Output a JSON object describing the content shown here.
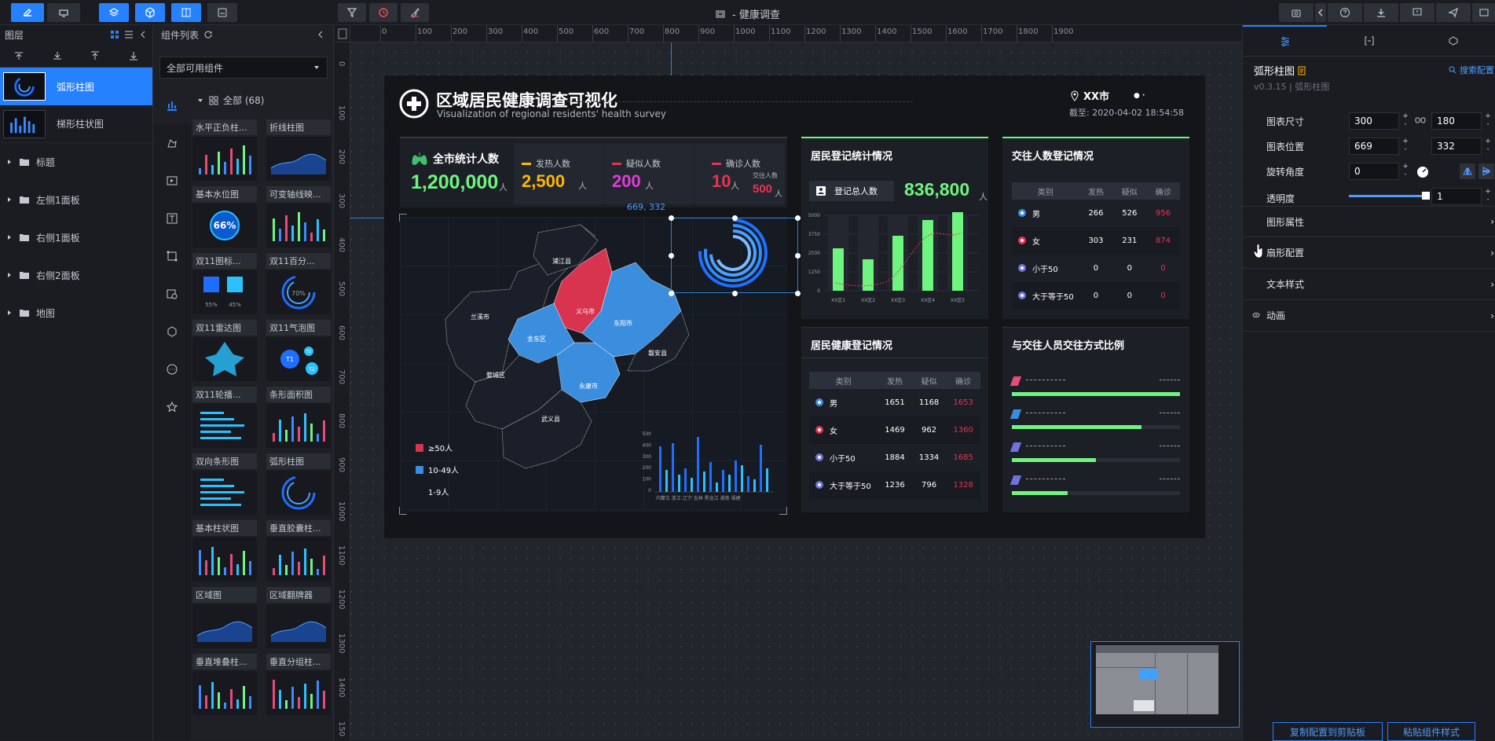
{
  "topbar": {
    "title": "- 健康调查"
  },
  "layers": {
    "header": "图层",
    "items": [
      {
        "label": "弧形柱图",
        "selected": true
      },
      {
        "label": "梯形柱状图",
        "selected": false
      }
    ],
    "folders": [
      "标题",
      "左侧1面板",
      "右侧1面板",
      "右侧2面板",
      "地图"
    ]
  },
  "components": {
    "header": "组件列表",
    "filter": "全部可用组件",
    "group": "全部 (68)",
    "items": [
      "水平正负柱...",
      "折线柱图",
      "基本水位图",
      "可变轴线映...",
      "双11图标...",
      "双11百分...",
      "双11雷达图",
      "双11气泡图",
      "双11轮播...",
      "条形面积图",
      "双向条形图",
      "弧形柱图",
      "基本柱状图",
      "垂直胶囊柱...",
      "区域图",
      "区域翻牌器",
      "垂直堆叠柱...",
      "垂直分组柱..."
    ],
    "preview_text": {
      "gauge": "66%",
      "pct_a": "55%",
      "pct_b": "45%",
      "ring": "70%",
      "bubble_a": "T1",
      "bubble_b": "T2",
      "bubble_c": "T2"
    }
  },
  "ruler": {
    "x": [
      "0",
      "100",
      "200",
      "300",
      "400",
      "500",
      "600",
      "700",
      "800",
      "900",
      "1000",
      "1100",
      "1200",
      "1300",
      "1400",
      "1500",
      "1600",
      "1700",
      "1800",
      "1900"
    ],
    "y": [
      "0",
      "100",
      "200",
      "300",
      "400",
      "500",
      "600",
      "700",
      "800",
      "900",
      "1000",
      "1100",
      "1200",
      "1300",
      "1400",
      "150"
    ]
  },
  "screen": {
    "title": "区域居民健康调查可视化",
    "subtitle": "Visualization of regional residents' health survey",
    "city": "XX市",
    "deadline": "截至: 2020-04-02 18:54:58",
    "coord_label": "669, 332",
    "stats": {
      "total_label": "全市统计人数",
      "total_value": "1,200,000",
      "total_unit": "人",
      "fever_label": "发热人数",
      "fever_value": "2,500",
      "fever_unit": "人",
      "suspect_label": "疑似人数",
      "suspect_value": "200",
      "suspect_unit": "人",
      "confirm_label": "确诊人数",
      "confirm_value": "10",
      "confirm_unit": "人",
      "contact_label": "交往人数",
      "contact_value": "500",
      "contact_unit": "人"
    },
    "map": {
      "regions": [
        "浦江县",
        "兰溪市",
        "义乌市",
        "东阳市",
        "金东区",
        "婺城区",
        "永康市",
        "磐安县",
        "武义县"
      ],
      "legend": [
        "≥50人",
        "10-49人",
        "1-9人"
      ],
      "mini_y": [
        "500",
        "400",
        "300",
        "200",
        "100",
        "0"
      ],
      "mini_x": "内蒙古 浙江 辽宁 吉林 黑龙江 湖南 福建"
    },
    "reg_panel": {
      "title": "居民登记统计情况",
      "total_label": "登记总人数",
      "total_value": "836,800",
      "total_unit": "人",
      "y_ticks": [
        "5000",
        "3750",
        "2500",
        "1250",
        "0"
      ],
      "x_ticks": [
        "XX区1",
        "XX区2",
        "XX区3",
        "XX区4",
        "XX区5"
      ]
    },
    "contact_panel": {
      "title": "交往人数登记情况",
      "headers": [
        "类别",
        "发热",
        "疑似",
        "确诊"
      ],
      "rows": [
        {
          "cat": "男",
          "a": "266",
          "b": "526",
          "c": "956"
        },
        {
          "cat": "女",
          "a": "303",
          "b": "231",
          "c": "874"
        },
        {
          "cat": "小于50",
          "a": "0",
          "b": "0",
          "c": "0"
        },
        {
          "cat": "大于等于50",
          "a": "0",
          "b": "0",
          "c": "0"
        }
      ]
    },
    "health_panel": {
      "title": "居民健康登记情况",
      "headers": [
        "类别",
        "发热",
        "疑似",
        "确诊"
      ],
      "rows": [
        {
          "cat": "男",
          "a": "1651",
          "b": "1168",
          "c": "1653"
        },
        {
          "cat": "女",
          "a": "1469",
          "b": "962",
          "c": "1360"
        },
        {
          "cat": "小于50",
          "a": "1884",
          "b": "1334",
          "c": "1685"
        },
        {
          "cat": "大于等于50",
          "a": "1236",
          "b": "796",
          "c": "1328"
        }
      ]
    },
    "ratio_panel": {
      "title": "与交往人员交往方式比例",
      "bars": [
        1.0,
        0.77,
        0.5,
        0.33
      ]
    }
  },
  "props": {
    "name": "弧形柱图",
    "version": "v0.3.15 | 弧形柱图",
    "search": "搜索配置",
    "size_label": "图表尺寸",
    "width": "300",
    "height": "180",
    "pos_label": "图表位置",
    "x": "669",
    "y": "332",
    "rot_label": "旋转角度",
    "rotation": "0",
    "opacity_label": "透明度",
    "opacity": "1",
    "sections": [
      "图形属性",
      "扇形配置",
      "文本样式",
      "动画"
    ],
    "copy_btn": "复制配置到剪贴板",
    "paste_btn": "粘贴组件样式"
  }
}
